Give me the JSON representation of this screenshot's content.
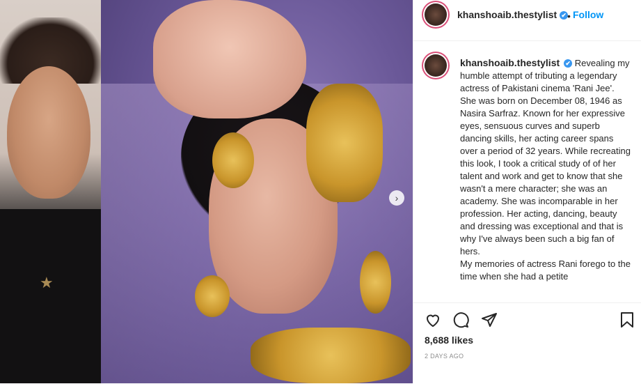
{
  "post": {
    "username": "khanshoaib.thestylist",
    "follow_label": "Follow",
    "separator": "•",
    "verified_icon": "✔",
    "caption_para1": "Revealing my humble attempt of tributing a legendary actress of Pakistani cinema 'Rani Jee'. She was born on December 08, 1946 as Nasira Sarfraz. Known for her expressive eyes, sensuous curves and superb dancing skills, her acting career spans over a period of 32 years. While recreating this look, I took a critical study of of her talent and work and get to know that she wasn't a mere character; she was an academy. She was incomparable in her profession. Her acting, dancing, beauty and dressing was exceptional and that is why I've always been such a big fan of hers.",
    "caption_para2": "My memories of actress Rani forego to the time when she had a petite",
    "likes": "8,688 likes",
    "timestamp": "2 DAYS AGO",
    "next_arrow": "›"
  },
  "colors": {
    "link": "#0095f6",
    "verified": "#3897f0",
    "story_ring": "#d94f78",
    "muted": "#8e8e8e"
  },
  "icons": [
    "heart-icon",
    "comment-icon",
    "share-icon",
    "save-icon",
    "chevron-right-icon",
    "verified-badge-icon"
  ]
}
